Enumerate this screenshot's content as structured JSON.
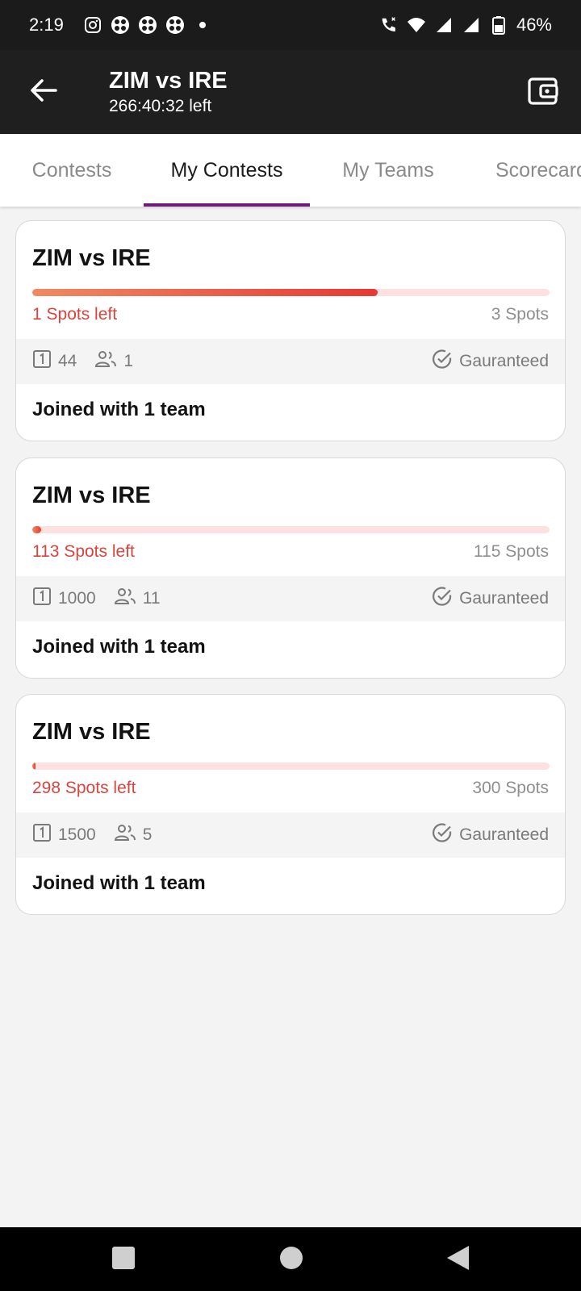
{
  "status_bar": {
    "time": "2:19",
    "battery": "46%",
    "left_icons": [
      "instagram-icon",
      "app-icon",
      "app-icon",
      "app-icon",
      "dot-icon"
    ],
    "right_icons": [
      "call-icon",
      "wifi-icon",
      "signal-icon",
      "signal-icon",
      "battery-icon"
    ]
  },
  "app_bar": {
    "title": "ZIM vs IRE",
    "subtitle": "266:40:32 left"
  },
  "tabs": [
    {
      "label": "Contests"
    },
    {
      "label": "My Contests"
    },
    {
      "label": "My Teams"
    },
    {
      "label": "Scorecard"
    }
  ],
  "contests": [
    {
      "title": "ZIM vs IRE",
      "spots_left": "1 Spots left",
      "total_spots": "3 Spots",
      "fill_fraction": 0.667,
      "entry": "44",
      "teams": "1",
      "guaranteed": "Gauranteed",
      "joined": "Joined with 1 team"
    },
    {
      "title": "ZIM vs IRE",
      "spots_left": "113 Spots left",
      "total_spots": "115 Spots",
      "fill_fraction": 0.017,
      "entry": "1000",
      "teams": "11",
      "guaranteed": "Gauranteed",
      "joined": "Joined with 1 team"
    },
    {
      "title": "ZIM vs IRE",
      "spots_left": "298 Spots left",
      "total_spots": "300 Spots",
      "fill_fraction": 0.007,
      "entry": "1500",
      "teams": "5",
      "guaranteed": "Gauranteed",
      "joined": "Joined with 1 team"
    }
  ],
  "colors": {
    "accent": "#6f1b7a",
    "spots_red": "#d9443c",
    "progress_start": "#f08a62",
    "progress_end": "#e53935",
    "track": "#fde0e0"
  }
}
